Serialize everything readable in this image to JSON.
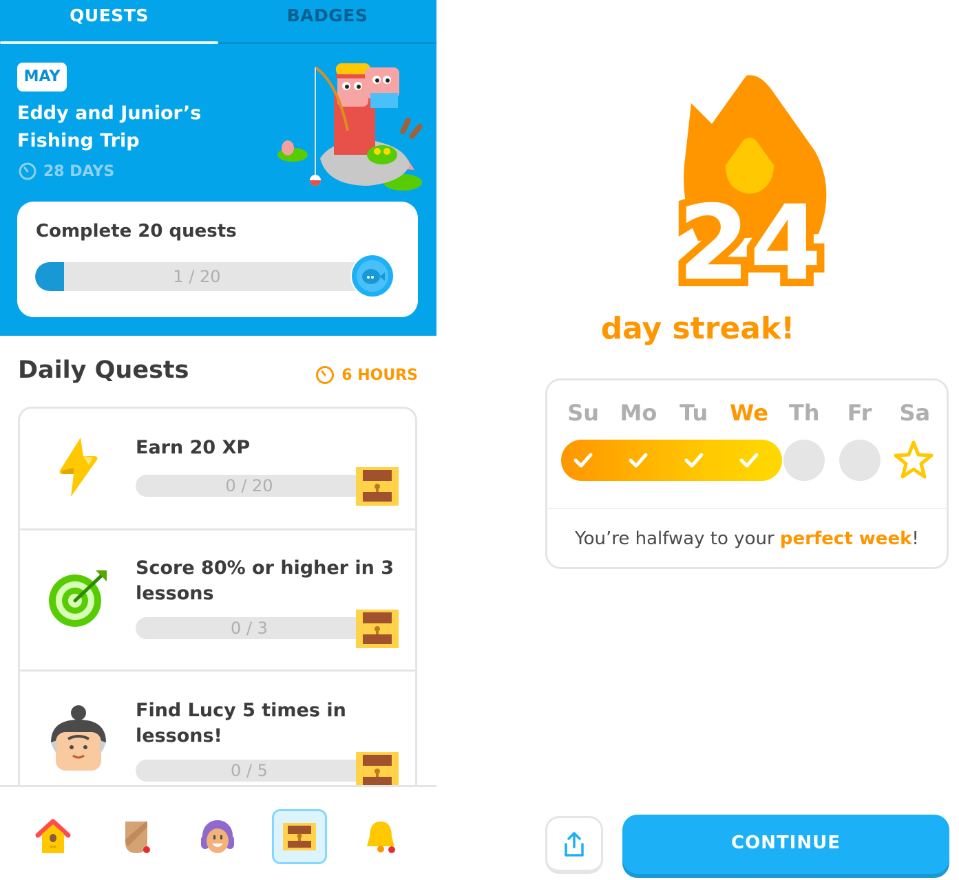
{
  "left": {
    "tabs": [
      {
        "label": "QUESTS",
        "active": true
      },
      {
        "label": "BADGES",
        "active": false
      }
    ],
    "monthly": {
      "month_badge": "MAY",
      "title": "Eddy and Junior’s Fishing Trip",
      "time_left": "28 DAYS",
      "challenge": "Complete 20 quests",
      "progress_text": "1 / 20",
      "progress_value": 1,
      "progress_max": 20
    },
    "daily": {
      "header": "Daily Quests",
      "time_left": "6 HOURS",
      "quests": [
        {
          "title": "Earn 20 XP",
          "progress_text": "0 / 20",
          "icon": "lightning-icon"
        },
        {
          "title": "Score 80% or higher in 3 lessons",
          "progress_text": "0 / 3",
          "icon": "target-icon"
        },
        {
          "title": "Find Lucy 5 times in lessons!",
          "progress_text": "0 / 5",
          "icon": "lucy-avatar-icon"
        }
      ]
    },
    "nav": [
      {
        "name": "home",
        "icon": "birdhouse-icon",
        "active": false
      },
      {
        "name": "leagues",
        "icon": "shield-icon",
        "active": false,
        "notification": true
      },
      {
        "name": "profile",
        "icon": "profile-avatar-icon",
        "active": false
      },
      {
        "name": "quests",
        "icon": "treasure-chest-icon",
        "active": true
      },
      {
        "name": "notifications",
        "icon": "bell-icon",
        "active": false,
        "notification": true
      }
    ]
  },
  "right": {
    "streak_count": "24",
    "streak_label": "day streak!",
    "days": [
      "Su",
      "Mo",
      "Tu",
      "We",
      "Th",
      "Fr",
      "Sa"
    ],
    "today_index": 3,
    "completed_days": 4,
    "message_prefix": "You’re halfway to your ",
    "message_highlight": "perfect week",
    "message_suffix": "!",
    "continue_label": "CONTINUE"
  },
  "colors": {
    "brand_blue": "#04a4ea",
    "button_blue": "#1cb0f6",
    "streak_orange": "#ff9600",
    "streak_yellow": "#ffc800",
    "neutral_gray": "#e5e5e5"
  }
}
